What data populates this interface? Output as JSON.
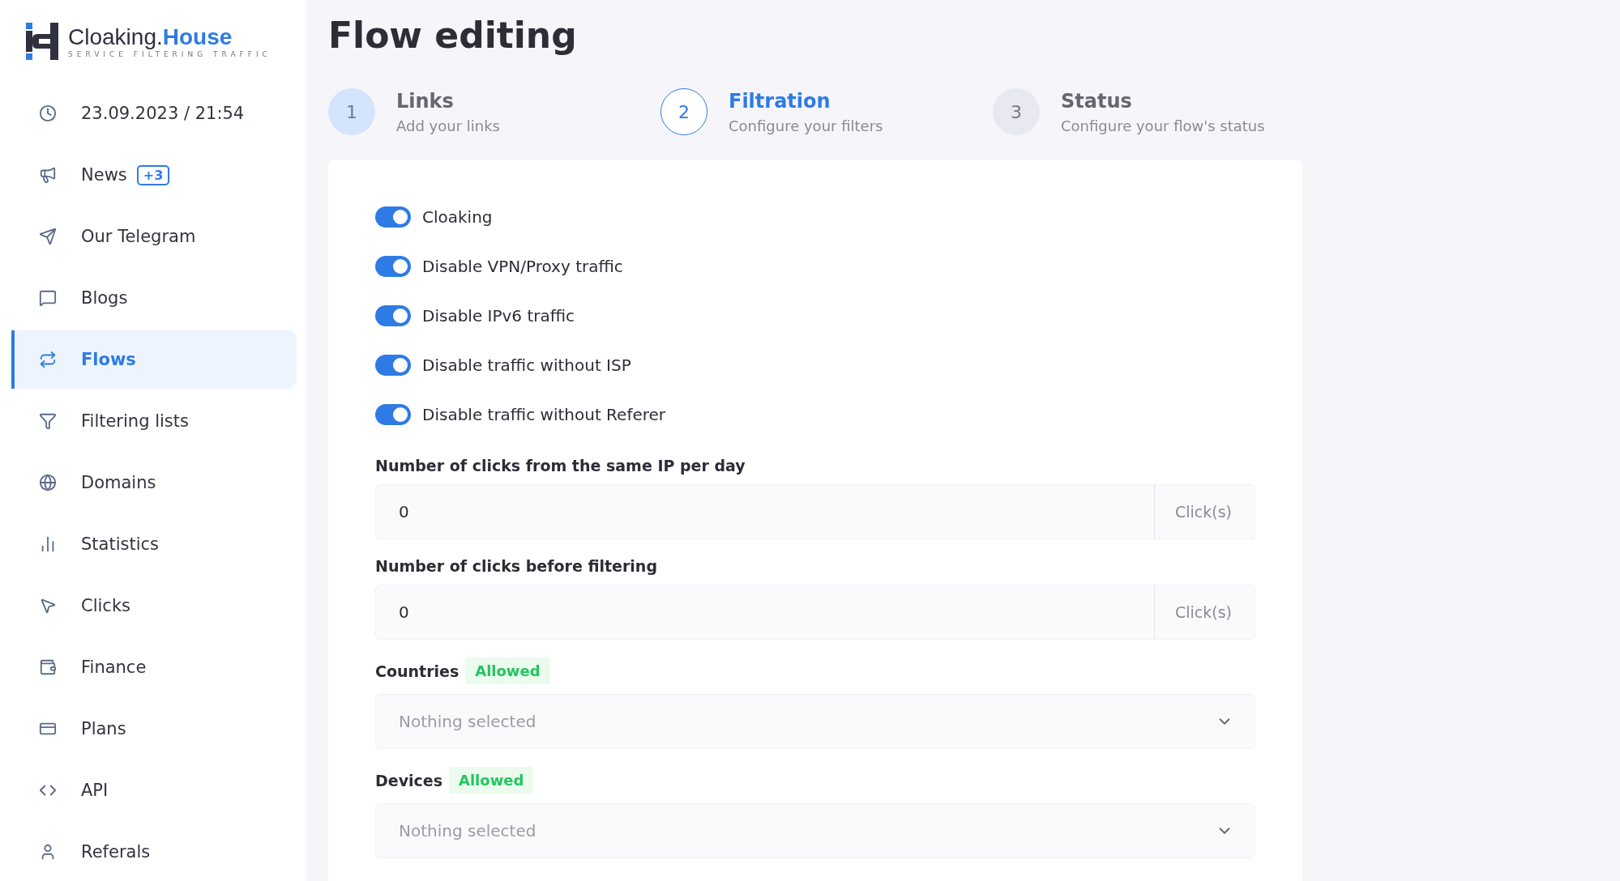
{
  "logo": {
    "name": "Cloaking.",
    "name_accent": "House",
    "tagline": "SERVICE FILTERING TRAFFIC"
  },
  "sidebar": {
    "items": [
      {
        "label": "23.09.2023 / 21:54",
        "selected": false
      },
      {
        "label": "News",
        "badge": "+3",
        "selected": false
      },
      {
        "label": "Our Telegram",
        "selected": false
      },
      {
        "label": "Blogs",
        "selected": false
      },
      {
        "label": "Flows",
        "selected": true
      },
      {
        "label": "Filtering lists",
        "selected": false
      },
      {
        "label": "Domains",
        "selected": false
      },
      {
        "label": "Statistics",
        "selected": false
      },
      {
        "label": "Clicks",
        "selected": false
      },
      {
        "label": "Finance",
        "selected": false
      },
      {
        "label": "Plans",
        "selected": false
      },
      {
        "label": "API",
        "selected": false
      },
      {
        "label": "Referals",
        "selected": false
      }
    ]
  },
  "page_title": "Flow editing",
  "steps": [
    {
      "number": "1",
      "title": "Links",
      "subtitle": "Add your links",
      "selected": false,
      "completed": true
    },
    {
      "number": "2",
      "title": "Filtration",
      "subtitle": "Configure your filters",
      "selected": true,
      "completed": false
    },
    {
      "number": "3",
      "title": "Status",
      "subtitle": "Configure your flow's status",
      "selected": false,
      "completed": false
    }
  ],
  "toggles": [
    {
      "label": "Cloaking",
      "on": true
    },
    {
      "label": "Disable VPN/Proxy traffic",
      "on": true
    },
    {
      "label": "Disable IPv6 traffic",
      "on": true
    },
    {
      "label": "Disable traffic without ISP",
      "on": true
    },
    {
      "label": "Disable traffic without Referer",
      "on": true
    }
  ],
  "fields": [
    {
      "kind": "number",
      "label": "Number of clicks from the same IP per day",
      "value": "0",
      "unit": "Click(s)"
    },
    {
      "kind": "number",
      "label": "Number of clicks before filtering",
      "value": "0",
      "unit": "Click(s)"
    },
    {
      "kind": "select",
      "label": "Countries",
      "badge": "Allowed",
      "placeholder": "Nothing selected"
    },
    {
      "kind": "select",
      "label": "Devices",
      "badge": "Allowed",
      "placeholder": "Nothing selected"
    }
  ]
}
